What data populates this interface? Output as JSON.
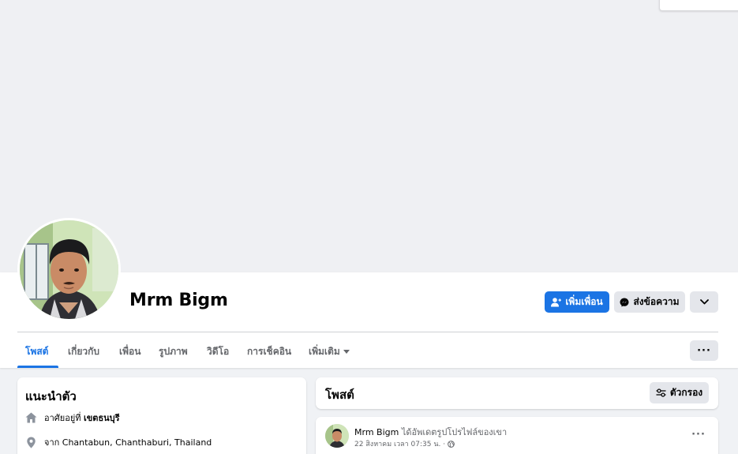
{
  "profile": {
    "name": "Mrm Bigm"
  },
  "actions": {
    "add_friend_label": "เพิ่มเพื่อน",
    "message_label": "ส่งข้อความ"
  },
  "tabs": [
    {
      "label": "โพสต์",
      "active": true
    },
    {
      "label": "เกี่ยวกับ"
    },
    {
      "label": "เพื่อน"
    },
    {
      "label": "รูปภาพ"
    },
    {
      "label": "วิดีโอ"
    },
    {
      "label": "การเช็คอิน"
    },
    {
      "label": "เพิ่มเติม"
    }
  ],
  "intro": {
    "title": "แนะนำตัว",
    "lives_prefix": "อาศัยอยู่ที่",
    "lives_place": "เขตธนบุรี",
    "from_text": "จาก Chantabun, Chanthaburi, Thailand"
  },
  "posts": {
    "title": "โพสต์",
    "filter_label": "ตัวกรอง",
    "items": [
      {
        "author": "Mrm Bigm",
        "action": "ได้อัพเดตรูปโปรไฟล์ของเขา",
        "timestamp": "22 สิงหาคม เวลา 07:35 น. ·"
      }
    ]
  },
  "colors": {
    "accent": "#1b74e4",
    "secondary_button": "#e4e6eb",
    "muted_text": "#65676b"
  },
  "icons": {
    "add_friend": "person-plus-icon",
    "message": "messenger-icon",
    "chevron": "chevron-down-icon",
    "more": "more-dots-icon",
    "home": "home-icon",
    "location": "location-pin-icon",
    "filter": "filter-sliders-icon",
    "privacy": "globe-icon"
  }
}
